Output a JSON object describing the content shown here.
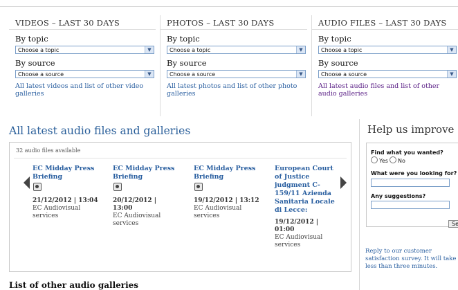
{
  "videos": {
    "title": "VIDEOS – LAST 30 DAYS",
    "by_topic": "By topic",
    "topic_value": "Choose a topic",
    "by_source": "By source",
    "source_value": "Choose a source",
    "link": "All latest videos and list of other video galleries"
  },
  "photos": {
    "title": "PHOTOS – LAST 30 DAYS",
    "by_topic": "By topic",
    "topic_value": "Choose a topic",
    "by_source": "By source",
    "source_value": "Choose a source",
    "link": "All latest photos and list of other photo galleries"
  },
  "audio_filter": {
    "title": "AUDIO FILES – LAST 30 DAYS",
    "by_topic": "By topic",
    "topic_value": "Choose a topic",
    "by_source": "By source",
    "source_value": "Choose a source",
    "link": "All latest audio files and list of other audio galleries"
  },
  "latest": {
    "heading": "All latest audio files and galleries",
    "count": "32 audio files available",
    "items": [
      {
        "title": "EC Midday Press Briefing",
        "date": "21/12/2012 | 13:04",
        "source": "EC Audiovisual services"
      },
      {
        "title": "EC Midday Press Briefing",
        "date": "20/12/2012 | 13:00",
        "source": "EC Audiovisual services"
      },
      {
        "title": "EC Midday Press Briefing",
        "date": "19/12/2012 | 13:12",
        "source": "EC Audiovisual services"
      },
      {
        "title": "European Court of Justice judgment C-159/11 Azienda Sanitaria Locale di Lecce:",
        "date": "19/12/2012 | 01:00",
        "source": "EC Audiovisual services"
      }
    ]
  },
  "other": {
    "heading": "List of other audio galleries"
  },
  "help": {
    "title": "Help us improve",
    "q1": "Find what you wanted?",
    "yes": "Yes",
    "no": "No",
    "q2": "What were you looking for?",
    "q3": "Any suggestions?",
    "send": "Sen",
    "note": "Reply to our customer satisfaction survey. It will take less than three minutes."
  }
}
